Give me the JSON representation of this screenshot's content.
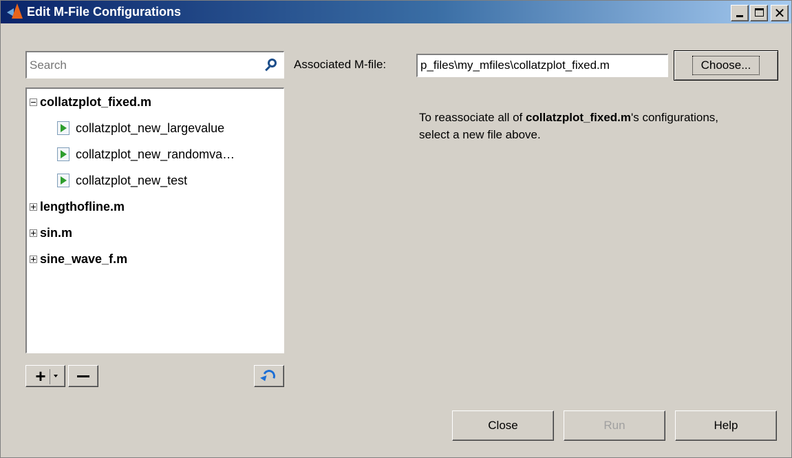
{
  "window": {
    "title": "Edit M-File Configurations",
    "minimize_label": "_",
    "close_label": "✕"
  },
  "search": {
    "placeholder": "Search"
  },
  "tree": {
    "nodes": [
      {
        "label": "collatzplot_fixed.m",
        "expanded": true,
        "children": [
          "collatzplot_new_largevalue",
          "collatzplot_new_randomva…",
          "collatzplot_new_test"
        ]
      },
      {
        "label": "lengthofline.m",
        "expanded": false
      },
      {
        "label": "sin.m",
        "expanded": false
      },
      {
        "label": "sine_wave_f.m",
        "expanded": false
      }
    ]
  },
  "tree_toolbar": {
    "add_label": "+",
    "remove_label": "−"
  },
  "associated": {
    "label": "Associated M-file:",
    "value": "p_files\\my_mfiles\\collatzplot_fixed.m",
    "choose_label": "Choose..."
  },
  "info": {
    "prefix": "To reassociate all of ",
    "file": "collatzplot_fixed.m",
    "suffix": "'s configurations, select a new file above."
  },
  "buttons": {
    "close": "Close",
    "run": "Run",
    "help": "Help"
  }
}
